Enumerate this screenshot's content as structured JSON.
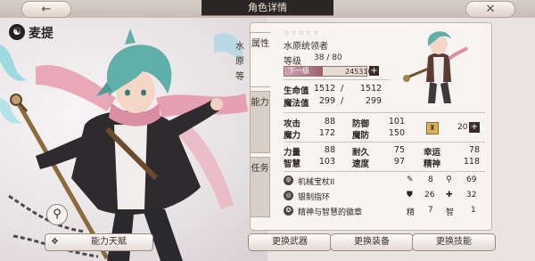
{
  "topbar": {
    "title": "角色详情",
    "back_icon": "←",
    "close_icon": "✕"
  },
  "character": {
    "element_icon": "☯",
    "name": "麦提",
    "stars": "☆☆☆☆☆",
    "title": "水原统领者",
    "title_cut": "水原 等"
  },
  "tabs": {
    "attributes": "属性",
    "abilities": "能力",
    "missions": "任务"
  },
  "level": {
    "label": "等级",
    "value": "38 / 80",
    "next_label": "下一级",
    "xp": "245310",
    "plus": "+"
  },
  "stats": {
    "hp_label": "生命值",
    "hp": "1512",
    "hp_sep": "/",
    "hp_max": "1512",
    "mp_label": "魔法值",
    "mp": "299",
    "mp_sep": "/",
    "mp_max": "299",
    "atk_label": "攻击",
    "atk": "88",
    "def_label": "防御",
    "def": "101",
    "matk_label": "魔力",
    "matk": "172",
    "mdef_label": "魔防",
    "mdef": "150",
    "str_label": "力量",
    "str": "88",
    "end_label": "耐久",
    "end": "75",
    "luck_label": "幸运",
    "luck": "78",
    "int_label": "智慧",
    "int": "103",
    "spd_label": "速度",
    "spd": "97",
    "spirit_label": "精神",
    "spirit": "118"
  },
  "gold": {
    "icon": "♜",
    "value": "20",
    "plus": "+"
  },
  "equipment": [
    {
      "icon": "⚙",
      "name": "机械宝杖II",
      "s1_icon": "✎",
      "s1": "8",
      "s2_icon": "⚲",
      "s2": "69"
    },
    {
      "icon": "◎",
      "name": "银制指环",
      "s1_icon": "⛊",
      "s1": "26",
      "s2_icon": "✚",
      "s2": "32"
    },
    {
      "icon": "✪",
      "name": "精神与智慧的徽章",
      "s1_icon": "精",
      "s1": "7",
      "s2_icon": "智",
      "s2": "1"
    }
  ],
  "buttons": {
    "talent_icon": "❖",
    "talent": "能力天赋",
    "zoom": "⚲",
    "change_weapon": "更换武器",
    "change_gear": "更换装备",
    "change_skill": "更换技能"
  },
  "colors": {
    "hair": "#5fb0a8",
    "scarf": "#d98fa3",
    "coat": "#2b2a2d",
    "xp_bar": "#a8687d"
  }
}
